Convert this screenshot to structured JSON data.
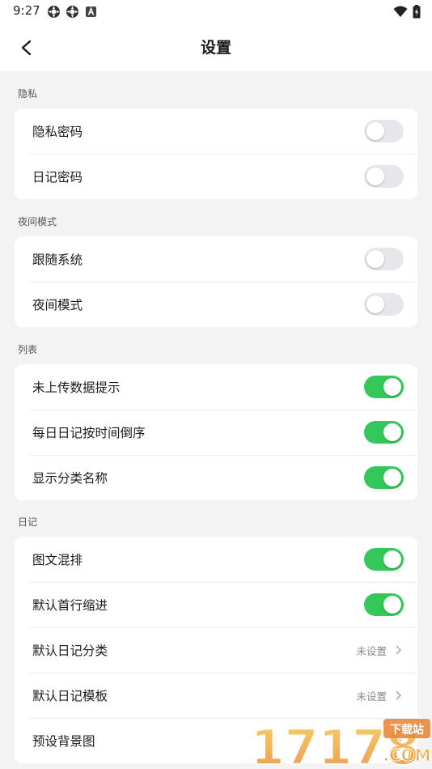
{
  "status_bar": {
    "time": "9:27"
  },
  "app_bar": {
    "title": "设置"
  },
  "sections": [
    {
      "label": "隐私",
      "rows": [
        {
          "label": "隐私密码",
          "toggle": false
        },
        {
          "label": "日记密码",
          "toggle": false
        }
      ]
    },
    {
      "label": "夜间模式",
      "rows": [
        {
          "label": "跟随系统",
          "toggle": false
        },
        {
          "label": "夜间模式",
          "toggle": false
        }
      ]
    },
    {
      "label": "列表",
      "rows": [
        {
          "label": "未上传数据提示",
          "toggle": true
        },
        {
          "label": "每日日记按时间倒序",
          "toggle": true
        },
        {
          "label": "显示分类名称",
          "toggle": true
        }
      ]
    },
    {
      "label": "日记",
      "rows": [
        {
          "label": "图文混排",
          "toggle": true
        },
        {
          "label": "默认首行缩进",
          "toggle": true
        },
        {
          "label": "默认日记分类",
          "value": "未设置"
        },
        {
          "label": "默认日记模板",
          "value": "未设置"
        },
        {
          "label": "预设背景图"
        }
      ]
    }
  ],
  "watermark": {
    "text": "17178",
    "sub": "下载站",
    "domain": ".COM"
  },
  "colors": {
    "toggle_on": "#34c759",
    "toggle_off": "#e7e7eb",
    "background": "#f3f3f3"
  },
  "icons": [
    "gear-icon",
    "gear-icon",
    "a-icon",
    "wifi-icon",
    "battery-icon",
    "back-arrow-icon",
    "chevron-right-icon"
  ]
}
